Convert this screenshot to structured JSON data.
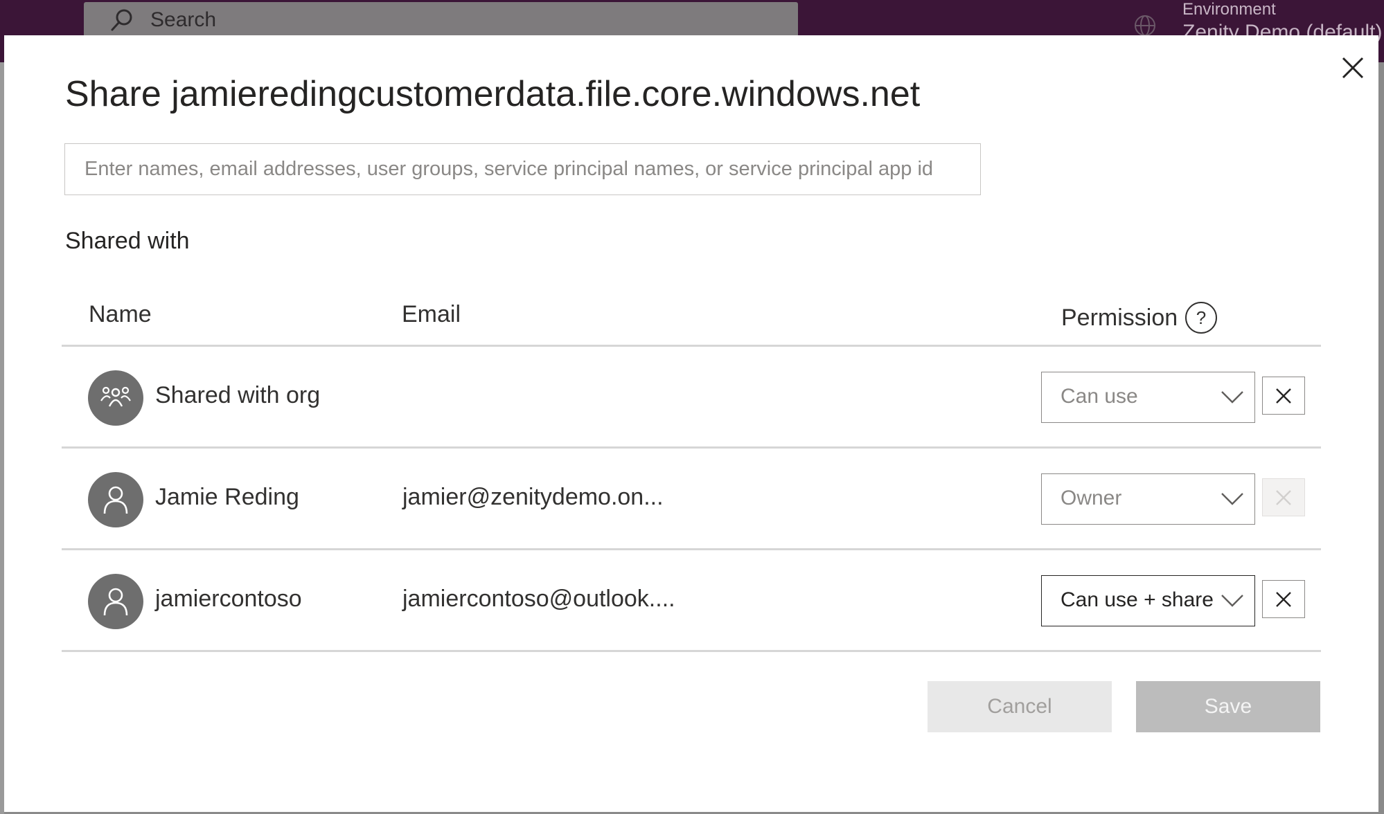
{
  "background": {
    "search_placeholder": "Search",
    "environment_label": "Environment",
    "environment_value": "Zenity Demo (default)"
  },
  "dialog": {
    "title": "Share jamieredingcustomerdata.file.core.windows.net",
    "input_placeholder": "Enter names, email addresses, user groups, service principal names, or service principal app id",
    "shared_with_label": "Shared with",
    "columns": {
      "name": "Name",
      "email": "Email",
      "permission": "Permission"
    },
    "rows": [
      {
        "name": "Shared with org",
        "email": "",
        "permission": "Can use",
        "avatar_icon": "group-icon",
        "removable": true
      },
      {
        "name": "Jamie Reding",
        "email": "jamier@zenitydemo.on...",
        "permission": "Owner",
        "avatar_icon": "person-icon",
        "removable": false
      },
      {
        "name": "jamiercontoso",
        "email": "jamiercontoso@outlook....",
        "permission": "Can use + share",
        "avatar_icon": "person-icon",
        "removable": true
      }
    ],
    "cancel_label": "Cancel",
    "save_label": "Save"
  },
  "colors": {
    "topbar": "#3b1537",
    "avatar": "#6e6e6e",
    "divider": "#d6d6d6",
    "save_disabled": "#bcbcbc"
  }
}
